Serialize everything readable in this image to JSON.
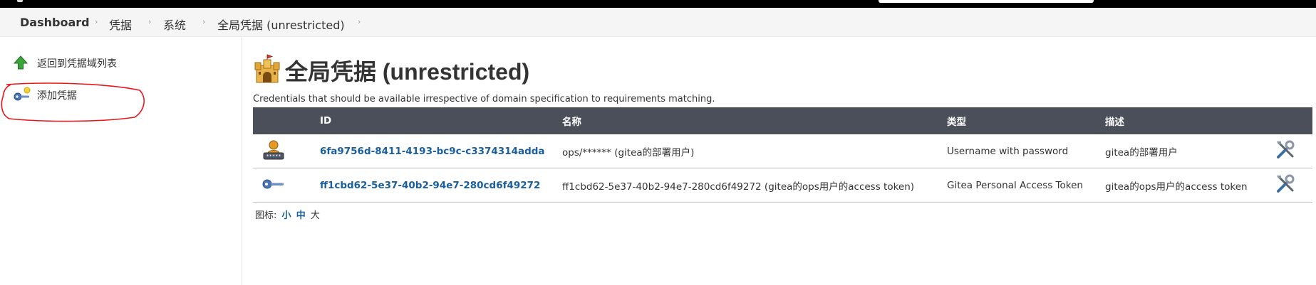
{
  "breadcrumb": {
    "items": [
      "Dashboard",
      "凭据",
      "系统",
      "全局凭据 (unrestricted)"
    ]
  },
  "sidebar": {
    "items": [
      {
        "label": "返回到凭据域列表",
        "icon": "green-up-arrow-icon"
      },
      {
        "label": "添加凭据",
        "icon": "add-key-icon"
      }
    ]
  },
  "page": {
    "title": "全局凭据 (unrestricted)",
    "title_icon": "castle-icon",
    "description": "Credentials that should be available irrespective of domain specification to requirements matching."
  },
  "table": {
    "headers": {
      "id": "ID",
      "name": "名称",
      "type": "类型",
      "desc": "描述"
    },
    "rows": [
      {
        "icon": "user-password-icon",
        "id": "6fa9756d-8411-4193-bc9c-c3374314adda",
        "name": "ops/****** (gitea的部署用户)",
        "type": "Username with password",
        "desc": "gitea的部署用户",
        "action_icon": "configure-tools-icon"
      },
      {
        "icon": "key-icon",
        "id": "ff1cbd62-5e37-40b2-94e7-280cd6f49272",
        "name": "ff1cbd62-5e37-40b2-94e7-280cd6f49272 (gitea的ops用户的access token)",
        "type": "Gitea Personal Access Token",
        "desc": "gitea的ops用户的access token",
        "action_icon": "configure-tools-icon"
      }
    ]
  },
  "icon_size": {
    "label": "图标:",
    "small": "小",
    "medium": "中",
    "large": "大"
  },
  "colors": {
    "table_header_bg": "#4b4f59",
    "link": "#1a5fa0",
    "annotation": "#e8141b"
  }
}
